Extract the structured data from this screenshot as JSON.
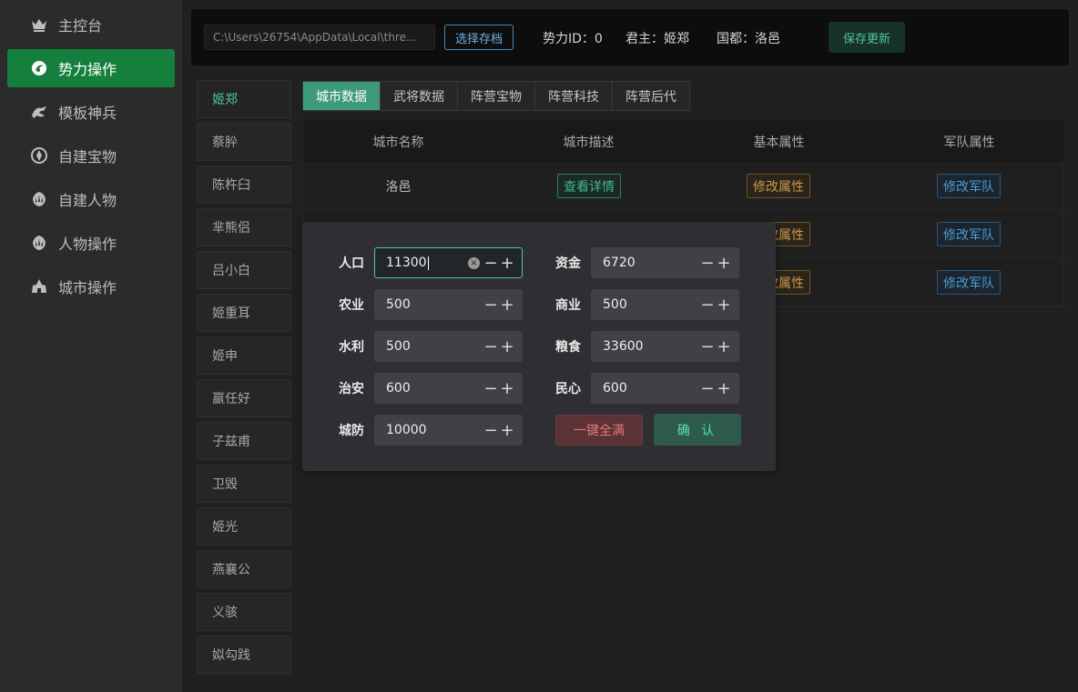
{
  "sidebar": {
    "items": [
      {
        "label": "主控台",
        "icon": "crown-icon"
      },
      {
        "label": "势力操作",
        "icon": "swirl-icon",
        "active": true
      },
      {
        "label": "模板神兵",
        "icon": "dragon-icon"
      },
      {
        "label": "自建宝物",
        "icon": "gem-icon"
      },
      {
        "label": "自建人物",
        "icon": "rebel-icon"
      },
      {
        "label": "人物操作",
        "icon": "rebel-icon"
      },
      {
        "label": "城市操作",
        "icon": "city-icon"
      }
    ]
  },
  "topbar": {
    "path": "C:\\Users\\26754\\AppData\\Local\\thre...",
    "select_save_label": "选择存档",
    "faction_id": "势力ID：0",
    "ruler": "君主：姬郑",
    "capital": "国都：洛邑",
    "save_update_label": "保存更新"
  },
  "factions": [
    "姬郑",
    "蔡肸",
    "陈杵臼",
    "芈熊侣",
    "吕小白",
    "姬重耳",
    "姬申",
    "嬴任好",
    "子兹甫",
    "卫毁",
    "姬光",
    "燕襄公",
    "义骇",
    "姒勾践"
  ],
  "tabs": [
    "城市数据",
    "武将数据",
    "阵营宝物",
    "阵营科技",
    "阵营后代"
  ],
  "table": {
    "headers": [
      "城市名称",
      "城市描述",
      "基本属性",
      "军队属性"
    ],
    "rows": [
      {
        "name": "洛邑",
        "detail": "查看详情",
        "attr": "修改属性",
        "army": "修改军队"
      },
      {
        "name": "",
        "detail": "",
        "attr": "改属性",
        "army": "修改军队"
      },
      {
        "name": "",
        "detail": "",
        "attr": "改属性",
        "army": "修改军队"
      }
    ]
  },
  "modal": {
    "fields": [
      {
        "label": "人口",
        "value": "11300"
      },
      {
        "label": "资金",
        "value": "6720"
      },
      {
        "label": "农业",
        "value": "500"
      },
      {
        "label": "商业",
        "value": "500"
      },
      {
        "label": "水利",
        "value": "500"
      },
      {
        "label": "粮食",
        "value": "33600"
      },
      {
        "label": "治安",
        "value": "600"
      },
      {
        "label": "民心",
        "value": "600"
      },
      {
        "label": "城防",
        "value": "10000"
      }
    ],
    "fill_all_label": "一键全满",
    "confirm_label": "确 认"
  },
  "colors": {
    "accent": "#15803d",
    "teal": "#3d9b7c",
    "danger": "#e3787b"
  }
}
